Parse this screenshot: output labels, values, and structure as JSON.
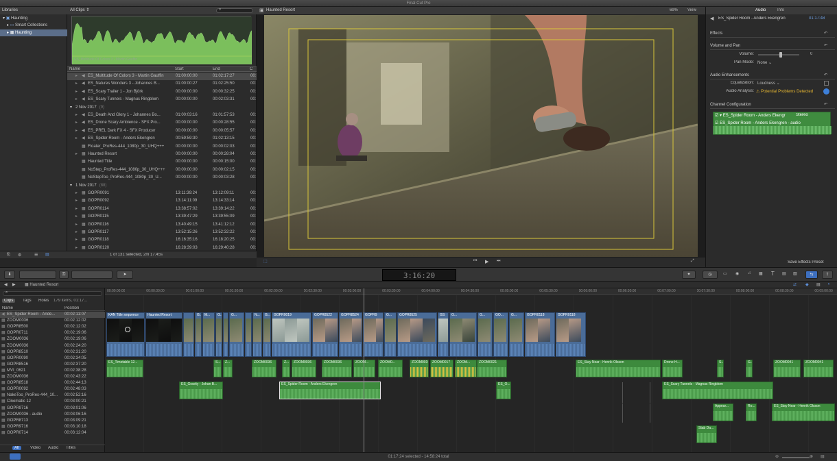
{
  "app": {
    "title": "Final Cut Pro"
  },
  "libraries": {
    "header": "Libraries",
    "items": [
      "Haunting",
      "Smart Collections",
      "Haunting"
    ]
  },
  "browser": {
    "filter": "All Clips",
    "preview_label": "ES_Multitude Of Colors 3 - Martin Gauffin",
    "columns": [
      "Name",
      "Start",
      "End",
      "C"
    ],
    "footer": "1 of 131 selected, 2m 17.45s",
    "groups": [
      {
        "label": "2 Nov 2017",
        "count": "(9)"
      },
      {
        "label": "1 Nov 2017",
        "count": "(88)"
      }
    ],
    "rows": [
      {
        "kind": "clip",
        "name": "ES_Multitude Of Colors 3 - Martin Gauffin",
        "start": "01:00:00:00",
        "end": "01:02:17:27",
        "c": "00:",
        "icon": "audio",
        "selected": true
      },
      {
        "kind": "clip",
        "name": "ES_Natures Wonders 3 - Johannes B...",
        "start": "01:00:00:27",
        "end": "01:02:25:50",
        "c": "00:",
        "icon": "audio"
      },
      {
        "kind": "clip",
        "name": "ES_Scary Trailer 1 - Jon Björk",
        "start": "00:00:00:00",
        "end": "00:00:32:25",
        "c": "00:",
        "icon": "audio"
      },
      {
        "kind": "clip",
        "name": "ES_Scary Tunnels - Magnus Ringblom",
        "start": "00:00:00:00",
        "end": "00:02:03:31",
        "c": "00:",
        "icon": "audio"
      },
      {
        "kind": "group",
        "g": 0
      },
      {
        "kind": "clip",
        "name": "ES_Death And Glory 1 - Johannes Bo...",
        "start": "01:00:03:16",
        "end": "01:01:57:53",
        "c": "00:",
        "icon": "audio"
      },
      {
        "kind": "clip",
        "name": "ES_Drone Scary Ambience - SFX Pro...",
        "start": "00:00:00:00",
        "end": "00:00:28:55",
        "c": "00:",
        "icon": "audio"
      },
      {
        "kind": "clip",
        "name": "ES_PREL Dark FX 4 - SFX Producer",
        "start": "00:00:00:00",
        "end": "00:00:05:57",
        "c": "00:",
        "icon": "audio"
      },
      {
        "kind": "clip",
        "name": "ES_Spider Room - Anders Ekengren",
        "start": "00:59:59:30",
        "end": "01:02:13:15",
        "c": "00:",
        "icon": "audio"
      },
      {
        "kind": "clip",
        "name": "Floater_ProRes-444_1080p_30_UHQ+++",
        "start": "00:00:00:00",
        "end": "00:00:02:03",
        "c": "00:",
        "icon": "video",
        "notri": true
      },
      {
        "kind": "clip",
        "name": "Haunted Resort",
        "start": "00:00:00:00",
        "end": "00:00:28:04",
        "c": "00:",
        "icon": "video"
      },
      {
        "kind": "clip",
        "name": "Haunted Title",
        "start": "00:00:00:00",
        "end": "00:00:15:00",
        "c": "00:",
        "icon": "video",
        "notri": true
      },
      {
        "kind": "clip",
        "name": "NoStep_ProRes-444_1080p_30_UHQ+++",
        "start": "00:00:00:00",
        "end": "00:00:02:15",
        "c": "00:",
        "icon": "video",
        "notri": true
      },
      {
        "kind": "clip",
        "name": "NoStepToo_ProRes-444_1080p_30_U...",
        "start": "00:00:00:00",
        "end": "00:00:03:28",
        "c": "00:",
        "icon": "video",
        "notri": true
      },
      {
        "kind": "group",
        "g": 1
      },
      {
        "kind": "clip",
        "name": "GOPR0091",
        "start": "13:11:39:24",
        "end": "13:12:09:11",
        "c": "00:",
        "icon": "video"
      },
      {
        "kind": "clip",
        "name": "GOPR0092",
        "start": "13:14:11:09",
        "end": "13:14:33:14",
        "c": "00:",
        "icon": "video"
      },
      {
        "kind": "clip",
        "name": "GOPR0114",
        "start": "13:38:57:02",
        "end": "13:39:14:22",
        "c": "00:",
        "icon": "video"
      },
      {
        "kind": "clip",
        "name": "GOPR0115",
        "start": "13:39:47:29",
        "end": "13:39:55:09",
        "c": "00:",
        "icon": "video"
      },
      {
        "kind": "clip",
        "name": "GOPR0116",
        "start": "13:40:49:15",
        "end": "13:41:12:12",
        "c": "00:",
        "icon": "video"
      },
      {
        "kind": "clip",
        "name": "GOPR0117",
        "start": "13:52:15:26",
        "end": "13:52:32:22",
        "c": "00:",
        "icon": "video"
      },
      {
        "kind": "clip",
        "name": "GOPR0118",
        "start": "16:16:35:16",
        "end": "16:18:20:25",
        "c": "00:",
        "icon": "video"
      },
      {
        "kind": "clip",
        "name": "GOPR0120",
        "start": "16:28:39:03",
        "end": "16:29:40:28",
        "c": "00:",
        "icon": "video"
      },
      {
        "kind": "clip",
        "name": "GOPR0121",
        "start": "16:30:43:22",
        "end": "16:31:01:00",
        "c": "00:",
        "icon": "video"
      }
    ]
  },
  "viewer": {
    "title": "Haunted Resort",
    "zoom": "69%",
    "view": "View"
  },
  "inspector": {
    "tabs": [
      "Audio",
      "Info"
    ],
    "clip": "ES_Spider Room - Anders Ekengren",
    "duration": "01:17:48",
    "sections": [
      "Effects",
      "Volume and Pan",
      "Audio Enhancements",
      "Channel Configuration"
    ],
    "volume_label": "Volume:",
    "volume_value": "0",
    "volume_level": 0.55,
    "pan_label": "Pan Mode:",
    "pan_value": "None",
    "eq_label": "Equalization:",
    "eq_value": "Loudness",
    "analysis_label": "Audio Analysis:",
    "analysis_value": "Potential Problems Detected",
    "channel_main": "ES_Spider Room - Anders Ekengr",
    "channel_format": "Stereo",
    "channel_sub": "ES_Spider Room - Anders Ekengren - audio",
    "save_preset": "Save Effects Preset"
  },
  "toolbar": {
    "timecode": "3:16:20"
  },
  "timeline": {
    "project": "Haunted Resort",
    "index_tabs": [
      "Clips",
      "Tags",
      "Roles"
    ],
    "index_count": "179 items, 01:17...",
    "index_cols": [
      "Name",
      "Position"
    ],
    "filters": [
      "All",
      "Video",
      "Audio",
      "Titles"
    ],
    "index_rows": [
      {
        "name": "ES_Spider Room - Ande...",
        "pos": "00:02:11:07",
        "sel": true
      },
      {
        "name": "ZOOM0036",
        "pos": "00:02:12:02"
      },
      {
        "name": "GOPR8500",
        "pos": "00:02:12:02"
      },
      {
        "name": "GOPR0711",
        "pos": "00:02:19:06"
      },
      {
        "name": "ZOOM0036",
        "pos": "00:02:19:06"
      },
      {
        "name": "ZOOM0036",
        "pos": "00:02:24:20"
      },
      {
        "name": "GOPR8510",
        "pos": "00:02:31:20"
      },
      {
        "name": "GOPR0090",
        "pos": "00:02:34:05"
      },
      {
        "name": "GOPR8516",
        "pos": "00:02:37:20"
      },
      {
        "name": "MVI_0621",
        "pos": "00:02:38:28"
      },
      {
        "name": "ZOOM0036",
        "pos": "00:02:43:22"
      },
      {
        "name": "GOPR8518",
        "pos": "00:02:44:13"
      },
      {
        "name": "GOPR0092",
        "pos": "00:02:48:03"
      },
      {
        "name": "NakeToo_ProRes-444_10...",
        "pos": "00:02:52:16"
      },
      {
        "name": "Cinematic 12",
        "pos": "00:03:00:21"
      },
      {
        "name": "GOPR9716",
        "pos": "00:03:01:06"
      },
      {
        "name": "ZOOM0036 - audio",
        "pos": "00:03:06:16"
      },
      {
        "name": "GOPR8713",
        "pos": "00:03:09:21"
      },
      {
        "name": "GOPR9716",
        "pos": "00:03:10:18"
      },
      {
        "name": "GOPR0714",
        "pos": "00:03:12:04"
      }
    ],
    "ruler_ticks": [
      "00:00:00:00",
      "00:00:30:00",
      "00:01:00:00",
      "00:01:30:00",
      "00:02:00:00",
      "00:02:30:00",
      "00:03:00:00",
      "00:03:30:00",
      "00:04:00:00",
      "00:04:30:00",
      "00:05:00:00",
      "00:05:30:00",
      "00:06:00:00",
      "00:06:30:00",
      "00:07:00:00",
      "00:07:30:00",
      "00:08:00:00",
      "00:08:30:00",
      "00:09:00:00"
    ],
    "video_clips": [
      {
        "label": "KAN Title sequence",
        "thumb": "dark"
      },
      {
        "label": "Haunted Resort",
        "thumb": "dark"
      },
      {
        "label": "",
        "thumb": "mix"
      },
      {
        "label": "G...",
        "thumb": "mix"
      },
      {
        "label": "M...",
        "thumb": "mix"
      },
      {
        "label": "G...",
        "thumb": "mix"
      },
      {
        "label": "",
        "thumb": "mix"
      },
      {
        "label": "G...",
        "thumb": "mix"
      },
      {
        "label": "",
        "thumb": "mix"
      },
      {
        "label": "N...",
        "thumb": "mix"
      },
      {
        "label": "G...",
        "thumb": "mix"
      },
      {
        "label": "GOPR0019",
        "thumb": "light"
      },
      {
        "label": "GOPR8522",
        "thumb": "people"
      },
      {
        "label": "GOPR8524",
        "thumb": "people"
      },
      {
        "label": "GOPR9",
        "thumb": "people"
      },
      {
        "label": "G...",
        "thumb": "mix"
      },
      {
        "label": "GOPR8525",
        "thumb": "people"
      },
      {
        "label": "GS",
        "thumb": "light"
      },
      {
        "label": "G...",
        "thumb": "mix"
      },
      {
        "label": "G...",
        "thumb": "mix"
      },
      {
        "label": "GO...",
        "thumb": "mix"
      },
      {
        "label": "G...",
        "thumb": "mix"
      },
      {
        "label": "GOPR0118",
        "thumb": "people"
      },
      {
        "label": "GOPR0118",
        "thumb": "people"
      }
    ],
    "audio_clips_lane1": [
      {
        "label": "ES_Timetable 12...",
        "w": 54
      },
      {
        "label": "S...",
        "w": 12
      },
      {
        "label": "Z...",
        "w": 14
      },
      {
        "label": "ZOOM0036",
        "w": 36
      },
      {
        "label": "Z...",
        "w": 12
      },
      {
        "label": "ZOOM0036",
        "w": 36
      },
      {
        "label": "ZOOM0036",
        "w": 44
      },
      {
        "label": "ZOOM...",
        "w": 32
      },
      {
        "label": "ZOOM0...",
        "w": 36
      },
      {
        "label": "ZOOM0019",
        "w": 28
      },
      {
        "label": "ZOOM0017",
        "w": 34
      },
      {
        "label": "ZOOM...",
        "w": 32
      },
      {
        "label": "ZOOM0021",
        "w": 44
      },
      {
        "label": "ES_Stay Near - Henrik Olsson",
        "w": 124
      },
      {
        "label": "Drone H...",
        "w": 30
      },
      {
        "label": "S...",
        "w": 10
      },
      {
        "label": "G...",
        "w": 10
      },
      {
        "label": "ZOOM0041",
        "w": 40
      },
      {
        "label": "ZOOM0041",
        "w": 44
      }
    ],
    "audio_clips_lane2": [
      {
        "label": "ES_Gravity - Johan B...",
        "w": 64
      },
      {
        "label": "ES_Spider Room - Anders Ekengren",
        "w": 148
      },
      {
        "label": "ES_O...",
        "w": 22
      },
      {
        "label": "ES_Scary Tunnels - Magnus Ringblom",
        "w": 162
      }
    ],
    "audio_clips_lane3": [
      {
        "label": "Appear...",
        "w": 30
      },
      {
        "label": "Ro...",
        "w": 16
      },
      {
        "label": "ES_Stay Near - Henrik Olsson",
        "w": 92
      }
    ],
    "audio_clips_lane4": [
      {
        "label": "Stab Da...",
        "w": 30
      }
    ]
  },
  "status": {
    "text": "01:17:24 selected - 14:58:24 total"
  }
}
